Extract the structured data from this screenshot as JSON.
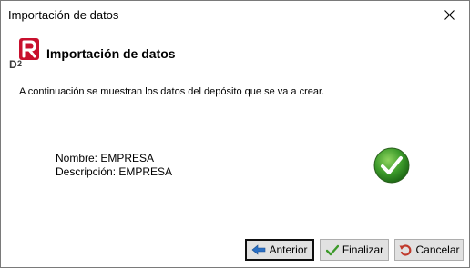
{
  "window": {
    "title": "Importación de datos"
  },
  "header": {
    "heading": "Importación de datos",
    "logo_icon": "d2-logo-icon"
  },
  "intro_text": "A continuación se muestran los datos del depósito que se va a crear.",
  "info": {
    "name_line": "Nombre: EMPRESA",
    "description_line": "Descripción: EMPRESA"
  },
  "status_icon": "green-checkmark-icon",
  "buttons": {
    "back_label": "Anterior",
    "finish_label": "Finalizar",
    "cancel_label": "Cancelar"
  },
  "colors": {
    "logo_red": "#c8102e",
    "check_green": "#3c9a2a",
    "back_arrow_blue": "#2a6fc4",
    "cancel_red": "#c0392b"
  }
}
